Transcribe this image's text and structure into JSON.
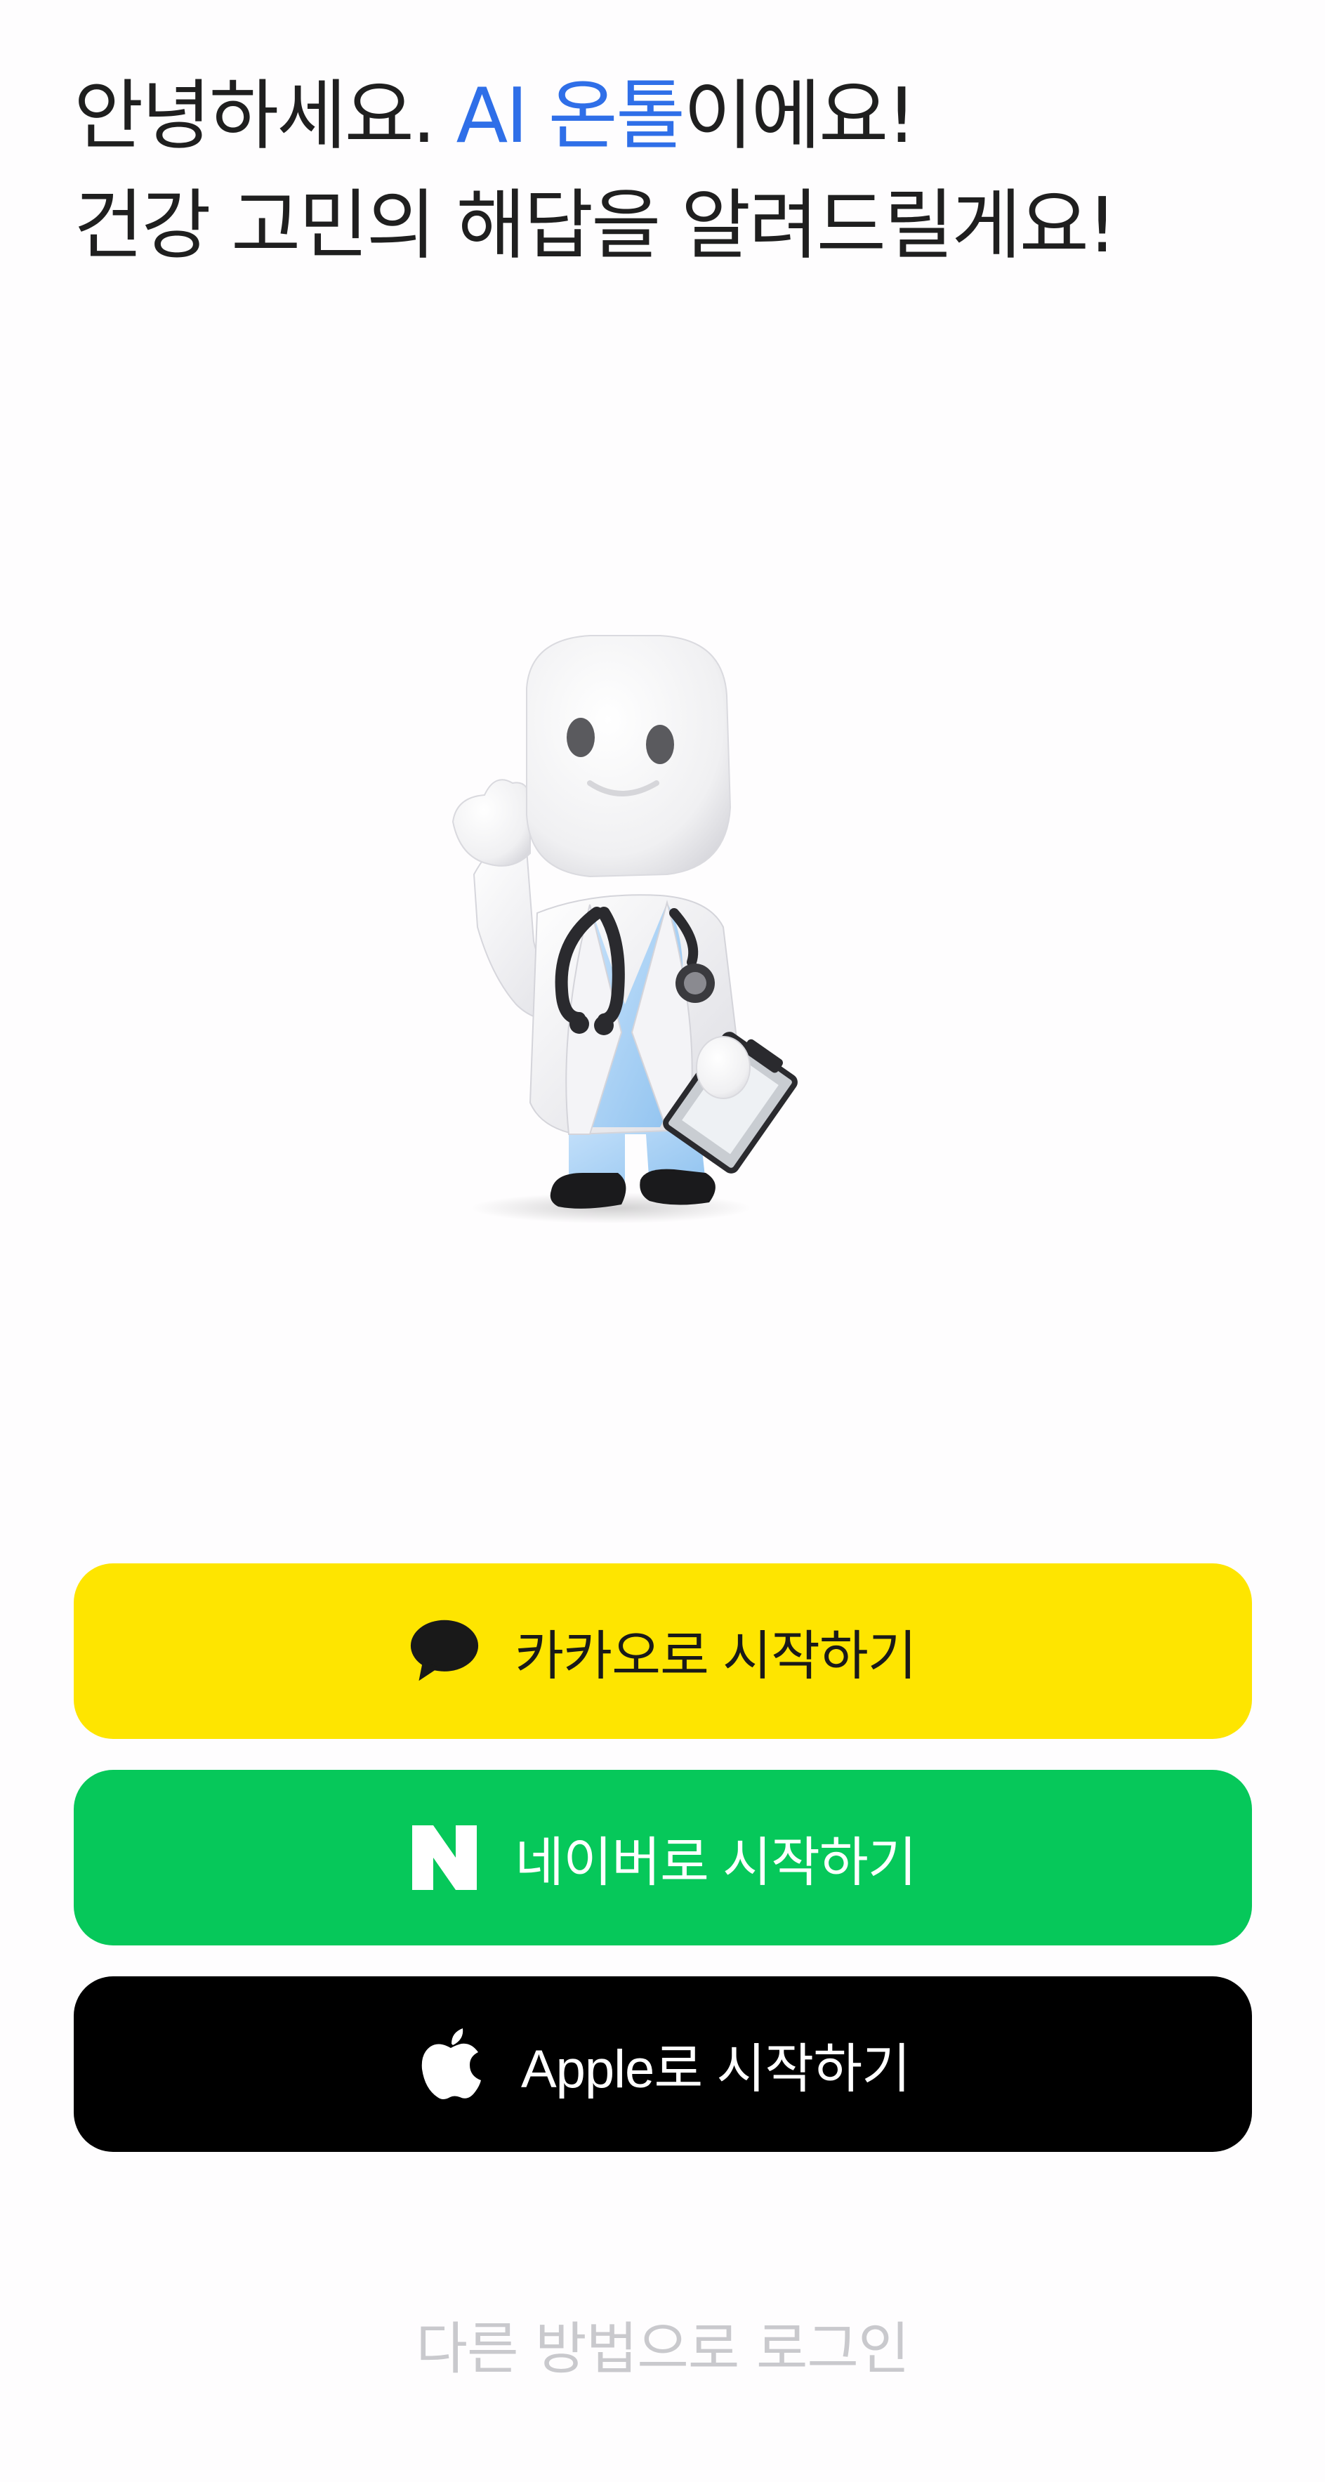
{
  "greeting": {
    "line1_prefix": "안녕하세요. ",
    "line1_highlight": "AI 온톨",
    "line1_suffix": "이에요!",
    "line2": "건강 고민의 해답을 알려드릴게요!"
  },
  "mascot": {
    "icon": "doctor-mascot-illustration"
  },
  "buttons": {
    "kakao": {
      "label": "카카오로 시작하기",
      "icon": "kakao-talk-icon"
    },
    "naver": {
      "label": "네이버로 시작하기",
      "icon": "naver-n-icon"
    },
    "apple": {
      "label": "Apple로 시작하기",
      "icon": "apple-icon"
    }
  },
  "other_login": {
    "label": "다른 방법으로 로그인"
  },
  "colors": {
    "accent": "#2f6fe8",
    "kakao": "#fee500",
    "naver": "#06c85a",
    "apple": "#000000",
    "muted_text": "#c9c9cd"
  }
}
